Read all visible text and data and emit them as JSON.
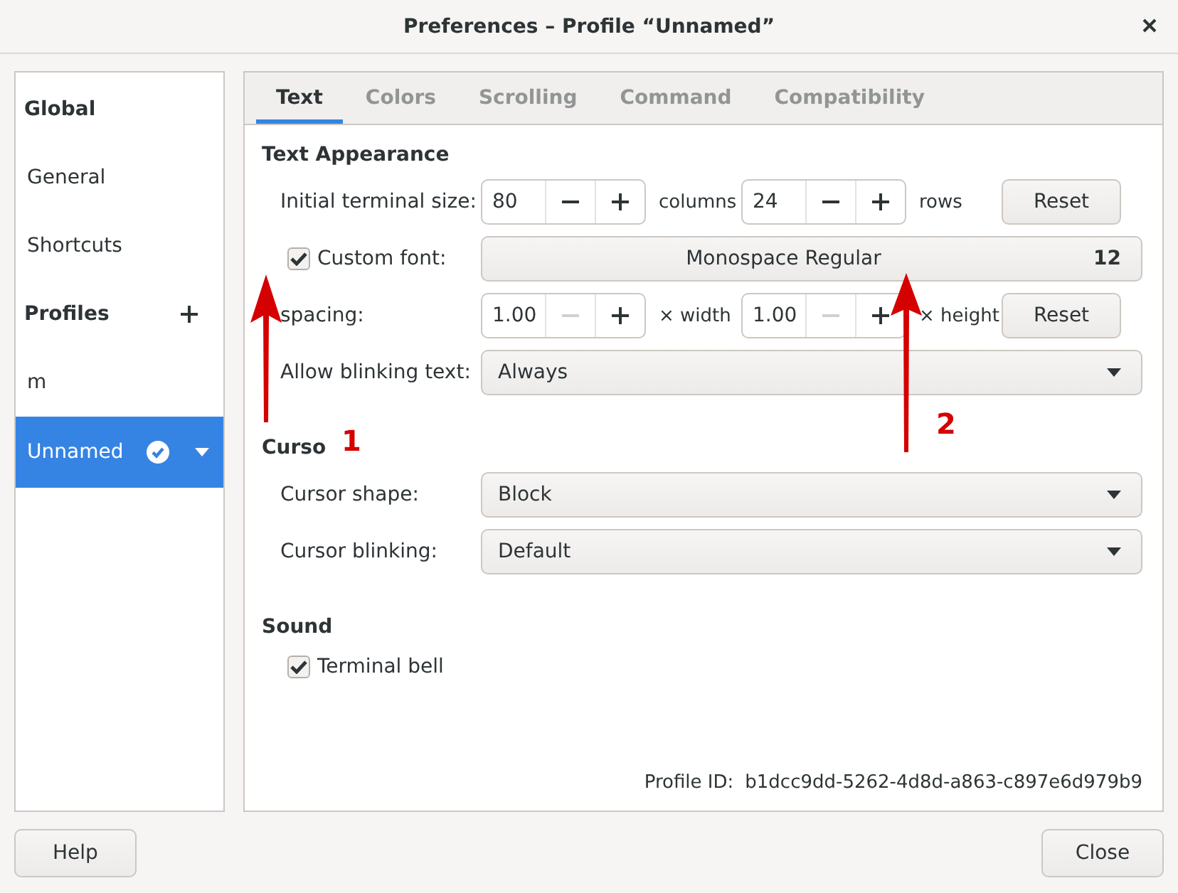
{
  "window": {
    "title": "Preferences – Profile “Unnamed”"
  },
  "sidebar": {
    "sections": [
      {
        "heading": "Global",
        "can_add": false,
        "items": [
          {
            "label": "General",
            "selected": false,
            "is_default": false
          },
          {
            "label": "Shortcuts",
            "selected": false,
            "is_default": false
          }
        ]
      },
      {
        "heading": "Profiles",
        "can_add": true,
        "items": [
          {
            "label": "m",
            "selected": false,
            "is_default": false
          },
          {
            "label": "Unnamed",
            "selected": true,
            "is_default": true
          }
        ]
      }
    ]
  },
  "tabs": [
    {
      "label": "Text",
      "selected": true
    },
    {
      "label": "Colors",
      "selected": false
    },
    {
      "label": "Scrolling",
      "selected": false
    },
    {
      "label": "Command",
      "selected": false
    },
    {
      "label": "Compatibility",
      "selected": false
    }
  ],
  "sections": [
    {
      "heading": "Text Appearance",
      "rows": [
        {
          "kind": "spins",
          "label": "Initial terminal size:",
          "spins": [
            {
              "value": "80",
              "unit": "columns",
              "minus_disabled": false,
              "plus_disabled": false
            },
            {
              "value": "24",
              "unit": "rows",
              "minus_disabled": false,
              "plus_disabled": false
            }
          ],
          "button": "Reset"
        },
        {
          "kind": "font",
          "label": "Custom font:",
          "checked": true,
          "font": "Monospace Regular",
          "size": "12"
        },
        {
          "kind": "spins",
          "label": "spacing:",
          "spins": [
            {
              "value": "1.00",
              "unit": "× width",
              "minus_disabled": true,
              "plus_disabled": false
            },
            {
              "value": "1.00",
              "unit": "× height",
              "minus_disabled": true,
              "plus_disabled": false
            }
          ],
          "button": "Reset"
        },
        {
          "kind": "dropdown",
          "label": "Allow blinking text:",
          "value": "Always"
        }
      ]
    },
    {
      "heading": "Curso",
      "rows": [
        {
          "kind": "dropdown",
          "label": "Cursor shape:",
          "value": "Block"
        },
        {
          "kind": "dropdown",
          "label": "Cursor blinking:",
          "value": "Default"
        }
      ]
    },
    {
      "heading": "Sound",
      "rows": [
        {
          "kind": "checkbox",
          "label": "Terminal bell",
          "checked": true
        }
      ]
    }
  ],
  "profile_id": {
    "label": "Profile ID:",
    "value": "b1dcc9dd-5262-4d8d-a863-c897e6d979b9"
  },
  "buttons": [
    {
      "label": "Help"
    },
    {
      "label": "Close"
    }
  ],
  "annotations": [
    {
      "label": "1"
    },
    {
      "label": "2"
    }
  ]
}
